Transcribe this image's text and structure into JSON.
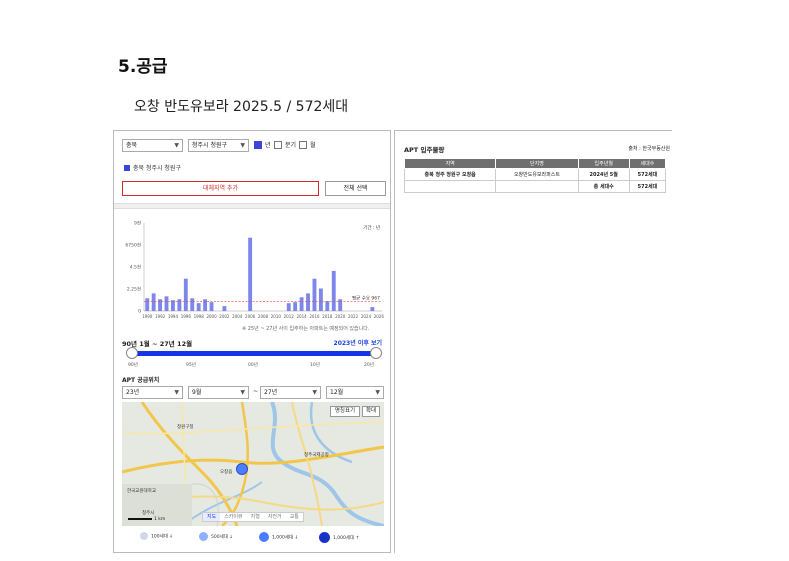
{
  "section_title": "5.공급",
  "subtitle": "오창 반도유보라 2025.5 / 572세대",
  "filters": {
    "province": "충북",
    "district": "청주시 청원구",
    "options": [
      {
        "label": "년",
        "checked": true
      },
      {
        "label": "분기",
        "checked": false
      },
      {
        "label": "월",
        "checked": false
      }
    ]
  },
  "selected_region": "충북 청주시 청원구",
  "compare_button": "대체지역 추가",
  "reset_button": "전체 선택",
  "chart_data": {
    "type": "bar",
    "y_ticks": [
      "9천",
      "6750천",
      "4.5천",
      "2.25천",
      "0"
    ],
    "ylim": [
      0,
      9000
    ],
    "x_tick_labels": [
      "1990",
      "1992",
      "1994",
      "1996",
      "1998",
      "2000",
      "2002",
      "2004",
      "2006",
      "2008",
      "2010",
      "2012",
      "2014",
      "2016",
      "2018",
      "2020",
      "2022",
      "2024",
      "2026"
    ],
    "categories": [
      1990,
      1991,
      1992,
      1993,
      1994,
      1995,
      1996,
      1997,
      1998,
      1999,
      2000,
      2001,
      2002,
      2003,
      2004,
      2005,
      2006,
      2007,
      2008,
      2009,
      2010,
      2011,
      2012,
      2013,
      2014,
      2015,
      2016,
      2017,
      2018,
      2019,
      2020,
      2021,
      2022,
      2023,
      2024,
      2025,
      2026
    ],
    "values": [
      1300,
      1800,
      1200,
      1500,
      1100,
      1200,
      3300,
      1300,
      800,
      1200,
      900,
      0,
      500,
      0,
      0,
      0,
      7500,
      0,
      0,
      0,
      0,
      0,
      800,
      900,
      1400,
      1800,
      3300,
      2300,
      1000,
      4100,
      1200,
      0,
      0,
      0,
      0,
      400,
      0
    ],
    "average_value": 967,
    "average_label": "평균 수요 967",
    "legend_label": "기간 : 년",
    "note": "※ 25년 ~ 27년 사이 입주하는 아파트는 예정되어 있습니다."
  },
  "range": {
    "label": "90년 1월 ~ 27년 12월",
    "after_link": "2023년 이후 보기",
    "start_fraction": 0.0,
    "end_fraction": 1.0,
    "tick_labels": [
      "90년",
      "95년",
      "00년",
      "10년",
      "20년"
    ]
  },
  "supply": {
    "label": "APT 공급위치",
    "from_year": "23년",
    "from_month": "9월",
    "separator": "~",
    "to_year": "27년",
    "to_month": "12월"
  },
  "map": {
    "btn_toggle": "명칭표기",
    "btn_zoom": "확대",
    "tabs": [
      "지도",
      "스카이뷰",
      "지형",
      "자전거",
      "교통"
    ],
    "active_tab": 0,
    "scale": "1 km",
    "places": [
      "청원구청",
      "청주시",
      "오창읍",
      "청주국제공항",
      "한국교원대학교"
    ]
  },
  "legend": [
    "100세대 ↓",
    "500세대 ↓",
    "1,000세대 ↓",
    "1,000세대 ↑"
  ],
  "right": {
    "title": "APT 입주물량",
    "source": "출처 : 한국부동산원",
    "headers": [
      "지역",
      "단지명",
      "입주년월",
      "세대수"
    ],
    "rows": [
      [
        "충북 청주 청원구 오창읍",
        "오창반도유보라퍼스트",
        "2024년 5월",
        "572세대"
      ],
      [
        "",
        "",
        "총 세대수",
        "572세대"
      ]
    ]
  }
}
